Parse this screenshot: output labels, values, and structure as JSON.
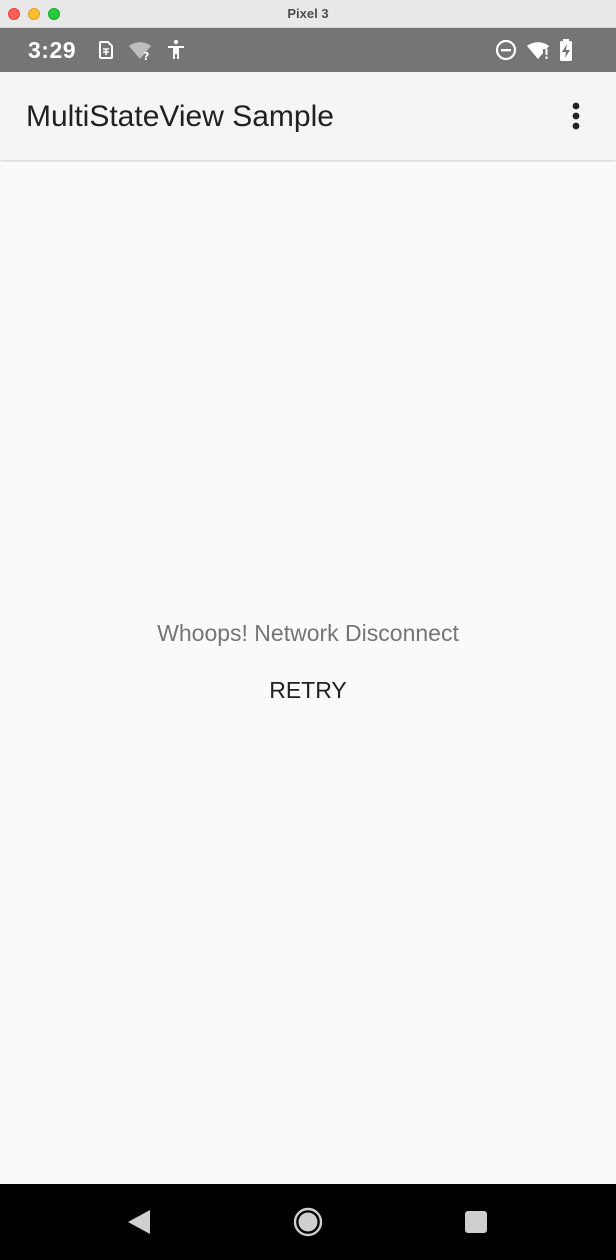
{
  "window": {
    "title": "Pixel 3"
  },
  "status_bar": {
    "time": "3:29",
    "icons": [
      "sim-card-icon",
      "wifi-unknown-icon",
      "accessibility-icon",
      "do-not-disturb-icon",
      "wifi-alert-icon",
      "battery-charging-icon"
    ],
    "background": "#757575"
  },
  "app_bar": {
    "title": "MultiStateView Sample",
    "overflow_icon": "more-vert-icon"
  },
  "content": {
    "error_message": "Whoops! Network Disconnect",
    "retry_label": "RETRY"
  },
  "nav_bar": {
    "buttons": [
      "back-icon",
      "home-icon",
      "recents-icon"
    ]
  },
  "colors": {
    "error_text": "#757575",
    "title_text": "#212121",
    "nav_bar": "#000000",
    "app_bar": "#f5f5f5"
  }
}
